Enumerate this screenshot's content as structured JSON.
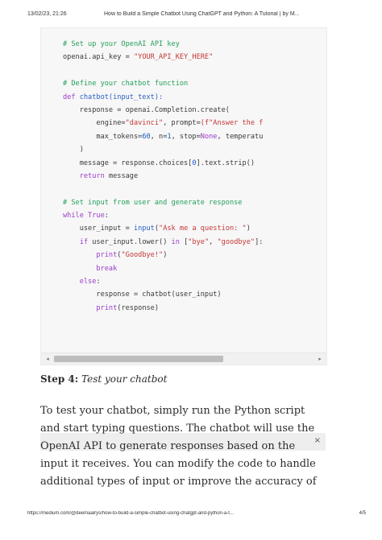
{
  "print_header": {
    "date": "13/02/23, 21:26",
    "title": "How to Build a Simple Chatbot Using ChatGPT and Python: A Tutorial | by M..."
  },
  "code": {
    "lines": [
      [
        {
          "t": "# Set up your OpenAI API key",
          "c": "comment"
        }
      ],
      [
        {
          "t": "openai.api_key = ",
          "c": "plain"
        },
        {
          "t": "\"YOUR_API_KEY_HERE\"",
          "c": "str"
        }
      ],
      [
        {
          "t": "",
          "c": "plain"
        }
      ],
      [
        {
          "t": "# Define your chatbot function",
          "c": "comment"
        }
      ],
      [
        {
          "t": "def ",
          "c": "kw"
        },
        {
          "t": "chatbot(input_text):",
          "c": "fn"
        }
      ],
      [
        {
          "t": "    response = openai.Completion.create(",
          "c": "plain"
        }
      ],
      [
        {
          "t": "        engine=",
          "c": "plain"
        },
        {
          "t": "\"davinci\"",
          "c": "str"
        },
        {
          "t": ", prompt=",
          "c": "plain"
        },
        {
          "t": "(f\"Answer the f",
          "c": "str"
        }
      ],
      [
        {
          "t": "        max_tokens=",
          "c": "plain"
        },
        {
          "t": "60",
          "c": "num"
        },
        {
          "t": ", n=",
          "c": "plain"
        },
        {
          "t": "1",
          "c": "num"
        },
        {
          "t": ", stop=",
          "c": "plain"
        },
        {
          "t": "None",
          "c": "kw"
        },
        {
          "t": ", temperatu",
          "c": "plain"
        }
      ],
      [
        {
          "t": "    )",
          "c": "plain"
        }
      ],
      [
        {
          "t": "    message = response.choices[",
          "c": "plain"
        },
        {
          "t": "0",
          "c": "num"
        },
        {
          "t": "].text.strip()",
          "c": "plain"
        }
      ],
      [
        {
          "t": "    ",
          "c": "plain"
        },
        {
          "t": "return",
          "c": "kw"
        },
        {
          "t": " message",
          "c": "plain"
        }
      ],
      [
        {
          "t": "",
          "c": "plain"
        }
      ],
      [
        {
          "t": "# Set input from user and generate response",
          "c": "comment"
        }
      ],
      [
        {
          "t": "while ",
          "c": "kw"
        },
        {
          "t": "True",
          "c": "kw"
        },
        {
          "t": ":",
          "c": "plain"
        }
      ],
      [
        {
          "t": "    user_input = ",
          "c": "plain"
        },
        {
          "t": "input",
          "c": "fn"
        },
        {
          "t": "(",
          "c": "plain"
        },
        {
          "t": "\"Ask me a question: \"",
          "c": "str"
        },
        {
          "t": ")",
          "c": "plain"
        }
      ],
      [
        {
          "t": "    ",
          "c": "plain"
        },
        {
          "t": "if",
          "c": "kw"
        },
        {
          "t": " user_input.lower() ",
          "c": "plain"
        },
        {
          "t": "in",
          "c": "kw"
        },
        {
          "t": " [",
          "c": "plain"
        },
        {
          "t": "\"bye\"",
          "c": "str"
        },
        {
          "t": ", ",
          "c": "plain"
        },
        {
          "t": "\"goodbye\"",
          "c": "str"
        },
        {
          "t": "]:",
          "c": "plain"
        }
      ],
      [
        {
          "t": "        ",
          "c": "plain"
        },
        {
          "t": "print",
          "c": "kw"
        },
        {
          "t": "(",
          "c": "plain"
        },
        {
          "t": "\"Goodbye!\"",
          "c": "str"
        },
        {
          "t": ")",
          "c": "plain"
        }
      ],
      [
        {
          "t": "        ",
          "c": "plain"
        },
        {
          "t": "break",
          "c": "kw"
        }
      ],
      [
        {
          "t": "    ",
          "c": "plain"
        },
        {
          "t": "else",
          "c": "kw"
        },
        {
          "t": ":",
          "c": "plain"
        }
      ],
      [
        {
          "t": "        response = chatbot(user_input)",
          "c": "plain"
        }
      ],
      [
        {
          "t": "        ",
          "c": "plain"
        },
        {
          "t": "print",
          "c": "kw"
        },
        {
          "t": "(response)",
          "c": "plain"
        }
      ]
    ],
    "scroll_left_glyph": "◂",
    "scroll_right_glyph": "▸"
  },
  "step": {
    "label": "Step 4:",
    "title": "Test your chatbot"
  },
  "paragraph": {
    "text": "To test your chatbot, simply run the Python script and start typing questions. The chatbot will use the OpenAI API to generate responses based on the input it receives. You can modify the code to handle additional types of input or improve the accuracy of"
  },
  "highlight": {
    "close_glyph": "×"
  },
  "print_footer": {
    "url": "https://medium.com/@deemaalrys/how-to-build-a-simple-chatbot-using-chatgpt-and-python-a-t...",
    "page": "4/5"
  },
  "colors": {
    "comment": "#24a05a",
    "keyword": "#9a3bc8",
    "string": "#c33737",
    "number": "#1e59c7"
  }
}
